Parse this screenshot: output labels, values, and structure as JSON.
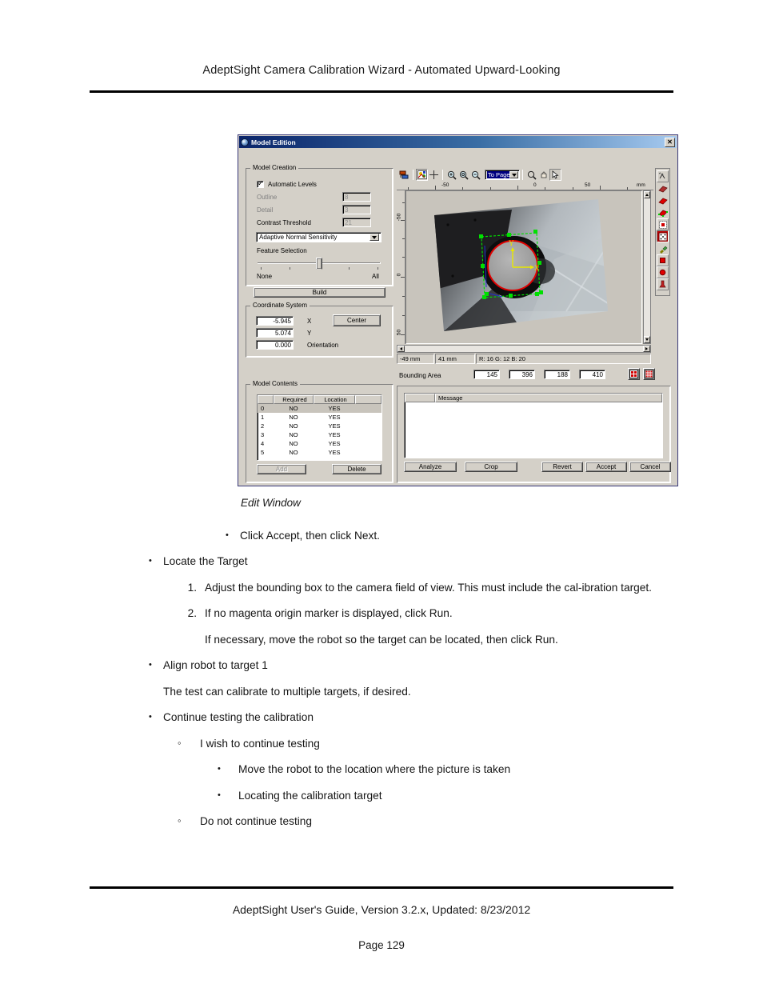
{
  "page": {
    "header_title": "AdeptSight Camera Calibration Wizard - Automated Upward-Looking",
    "footer_guide": "AdeptSight User's Guide,  Version 3.2.x, Updated: 8/23/2012",
    "footer_page": "Page 129",
    "figure_caption": "Edit Window"
  },
  "body": {
    "first_bullet": "Click Accept, then click Next.",
    "locate_target": "Locate the Target",
    "step1_num": "1.",
    "step1_text": "Adjust the bounding box to the camera field of view. This must include the cal-ibration target.",
    "step2_num": "2.",
    "step2_text": "If no magenta origin marker is displayed, click Run.",
    "step2_note": "If necessary, move the robot so the target can be located, then click Run.",
    "align_robot": "Align robot to target 1",
    "align_note": "The test can calibrate to multiple targets, if desired.",
    "continue_testing": "Continue testing the calibration",
    "wish_continue": "I wish to continue testing",
    "move_robot": "Move the robot to the location where the picture is taken",
    "locating_target": "Locating the calibration target",
    "do_not_continue": "Do not continue testing"
  },
  "dialog": {
    "title": "Model Edition",
    "close_label": "✕",
    "model_creation": {
      "group_label": "Model Creation",
      "automatic_levels_label": "Automatic Levels",
      "automatic_levels_checked": true,
      "outline_label": "Outline",
      "outline_value": "8",
      "detail_label": "Detail",
      "detail_value": "3",
      "contrast_label": "Contrast Threshold",
      "contrast_value": "21",
      "sensitivity_value": "Adaptive Normal Sensitivity",
      "feature_selection_label": "Feature Selection",
      "slider_min_label": "None",
      "slider_max_label": "All",
      "build_label": "Build"
    },
    "coordinate_system": {
      "group_label": "Coordinate System",
      "x_value": "-5.945",
      "x_label": "X",
      "y_value": "5.074",
      "y_label": "Y",
      "orientation_value": "0.000",
      "orientation_label": "Orientation",
      "center_label": "Center"
    },
    "model_contents": {
      "group_label": "Model Contents",
      "columns": [
        "",
        "Required",
        "Location",
        ""
      ],
      "rows": [
        {
          "index": "0",
          "required": "NO",
          "location": "YES"
        },
        {
          "index": "1",
          "required": "NO",
          "location": "YES"
        },
        {
          "index": "2",
          "required": "NO",
          "location": "YES"
        },
        {
          "index": "3",
          "required": "NO",
          "location": "YES"
        },
        {
          "index": "4",
          "required": "NO",
          "location": "YES"
        },
        {
          "index": "5",
          "required": "NO",
          "location": "YES"
        }
      ],
      "add_label": "Add",
      "delete_label": "Delete"
    },
    "toolbar": {
      "zoom_mode_value": "To Page",
      "icons": [
        "layout-icon",
        "build-model-icon",
        "crosshair-icon",
        "zoom-in-icon",
        "zoom-actual-icon",
        "zoom-out-icon",
        "magnifier-icon",
        "pan-hand-icon",
        "select-arrow-icon"
      ]
    },
    "rulers": {
      "horizontal_ticks": [
        "-50",
        "0",
        "50"
      ],
      "unit": "mm",
      "vertical_ticks": [
        "-50",
        "0",
        "50"
      ]
    },
    "status": {
      "x_pos": "-49 mm",
      "y_pos": "41 mm",
      "rgb": "R: 16 G: 12 B: 20"
    },
    "bounding_area": {
      "label": "Bounding Area",
      "values": [
        "145",
        "396",
        "188",
        "410"
      ]
    },
    "message_panel": {
      "column_header": "Message",
      "rows": []
    },
    "buttons": {
      "analyze": "Analyze",
      "crop": "Crop",
      "revert": "Revert",
      "accept": "Accept",
      "cancel": "Cancel"
    },
    "right_toolbar_icons": [
      "model-features-icon",
      "edge-segment-icon",
      "filled-shape-icon",
      "shape-nodes-icon",
      "select-region-icon",
      "mask-region-icon",
      "eyedropper-icon",
      "rectangle-icon",
      "ellipse-icon",
      "polygon-icon"
    ],
    "colors": {
      "face": "#d4d0c8",
      "title_start": "#0a246a",
      "title_end": "#a6caf0",
      "accent_red": "#cc0000",
      "accent_green": "#00e000",
      "accent_yellow": "#e8e800"
    }
  }
}
